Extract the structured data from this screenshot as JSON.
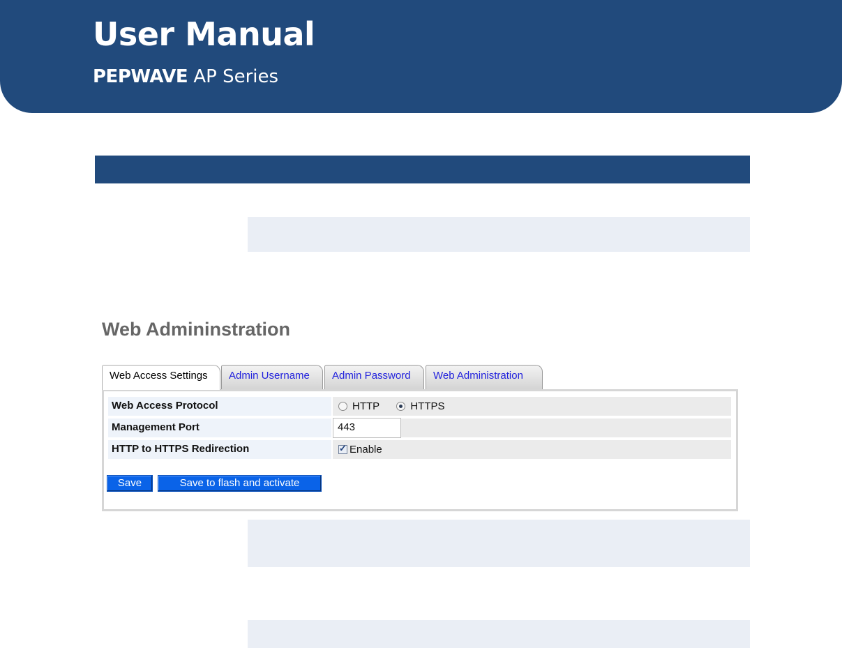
{
  "document": {
    "title": "User Manual",
    "subtitle_brand": "PEPWAVE",
    "subtitle_rest": "AP Series"
  },
  "ui": {
    "heading": "Web Admininstration",
    "tabs": [
      {
        "label": "Web Access Settings",
        "active": true
      },
      {
        "label": "Admin Username",
        "active": false
      },
      {
        "label": "Admin Password",
        "active": false
      },
      {
        "label": "Web Administration",
        "active": false
      }
    ],
    "fields": {
      "protocol": {
        "label": "Web Access Protocol",
        "options": [
          "HTTP",
          "HTTPS"
        ],
        "selected": "HTTPS"
      },
      "port": {
        "label": "Management Port",
        "value": "443"
      },
      "redirect": {
        "label": "HTTP to HTTPS Redirection",
        "checkbox_label": "Enable",
        "checked": true
      }
    },
    "buttons": {
      "save": "Save",
      "save_activate": "Save to flash and activate"
    }
  },
  "colors": {
    "header_blue": "#214a7c",
    "button_blue": "#0a63e8",
    "tab_link": "#2222dd"
  }
}
